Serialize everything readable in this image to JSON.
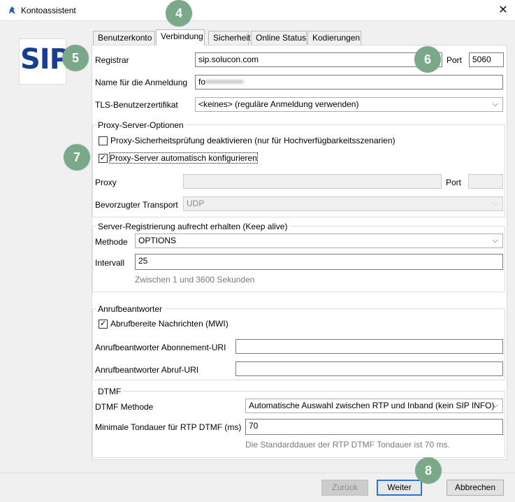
{
  "window": {
    "title": "Kontoassistent",
    "close_label": "✕"
  },
  "logo_text": "SIP",
  "tabs": [
    {
      "label": "Benutzerkonto"
    },
    {
      "label": "Verbindung"
    },
    {
      "label": "Sicherheit"
    },
    {
      "label": "Online Status"
    },
    {
      "label": "Kodierungen"
    }
  ],
  "form": {
    "registrar_label": "Registrar",
    "registrar_value": "sip.solucon.com",
    "port_label": "Port",
    "port_value": "5060",
    "login_label": "Name für die Anmeldung",
    "login_value": "fo",
    "login_value_blurred": "•••••••••••••",
    "tls_label": "TLS-Benutzerzertifikat",
    "tls_value": "<keines> (reguläre Anmeldung verwenden)"
  },
  "proxy": {
    "group_title": "Proxy-Server-Optionen",
    "check1_label": "Proxy-Sicherheitsprüfung deaktivieren (nur für Hochverfügbarkeitsszenarien)",
    "check1_checked": false,
    "check2_label": "Proxy-Server automatisch konfigurieren",
    "check2_checked": true,
    "check_mark": "✓",
    "proxy_label": "Proxy",
    "proxy_value": "",
    "port_label": "Port",
    "port_value": "",
    "transport_label": "Bevorzugter Transport",
    "transport_value": "UDP"
  },
  "keepalive": {
    "group_title": "Server-Registrierung aufrecht erhalten (Keep alive)",
    "method_label": "Methode",
    "method_value": "OPTIONS",
    "interval_label": "Intervall",
    "interval_value": "25",
    "interval_hint": "Zwischen 1 und 3600 Sekunden"
  },
  "voicemail": {
    "group_title": "Anrufbeantworter",
    "mwi_label": "Abrufbereite Nachrichten (MWI)",
    "mwi_checked": true,
    "subscription_label": "Anrufbeantworter Abonnement-URI",
    "subscription_value": "",
    "retrieval_label": "Anrufbeantworter Abruf-URI",
    "retrieval_value": ""
  },
  "dtmf": {
    "group_title": "DTMF",
    "method_label": "DTMF Methode",
    "method_value": "Automatische Auswahl zwischen RTP und Inband (kein SIP INFO)",
    "min_duration_label": "Minimale Tondauer für RTP DTMF (ms)",
    "min_duration_value": "70",
    "hint": "Die Standarddauer der RTP DTMF Tondauer ist 70 ms."
  },
  "badges": {
    "b4": "4",
    "b5": "5",
    "b6": "6",
    "b7": "7",
    "b8": "8"
  },
  "buttons": {
    "back": "Zurück",
    "next": "Weiter",
    "cancel": "Abbrechen"
  },
  "icons": {
    "chevron": "⌵"
  },
  "colors": {
    "badge": "#7aa98a",
    "logo": "#163f8f",
    "default_button_border": "#2f74c8"
  }
}
